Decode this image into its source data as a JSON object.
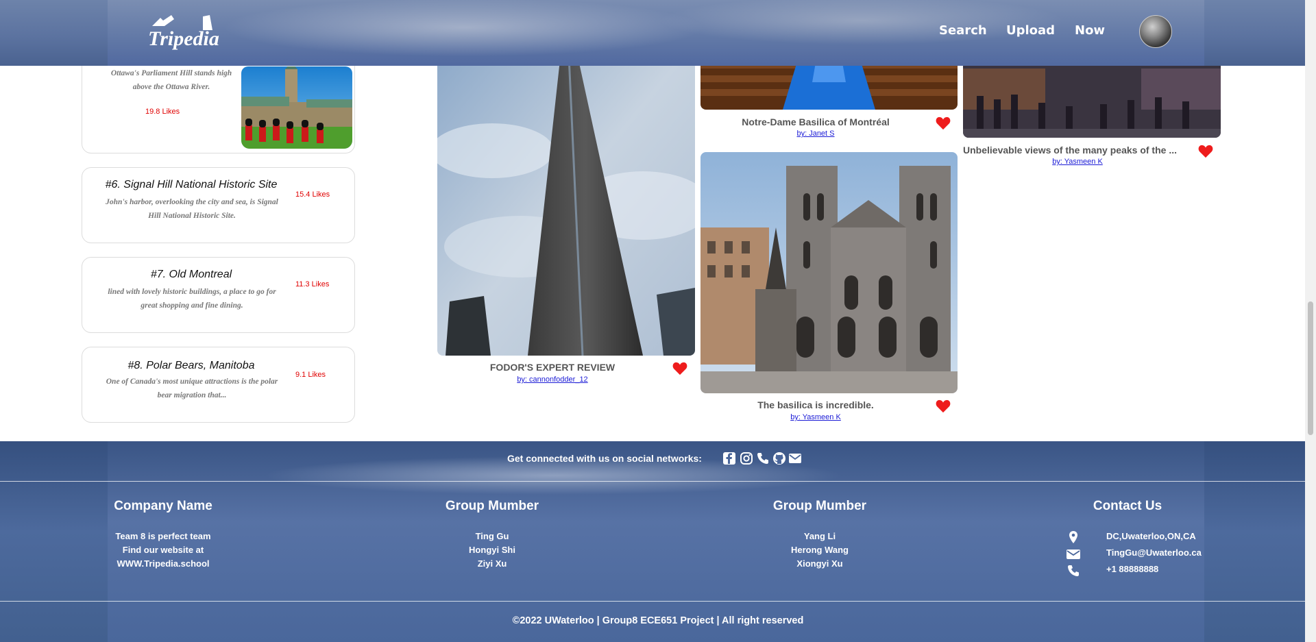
{
  "header": {
    "logo_text": "Tripedia",
    "nav": [
      {
        "label": "Search"
      },
      {
        "label": "Upload"
      },
      {
        "label": "Now"
      }
    ]
  },
  "rankings": [
    {
      "title": "",
      "desc_line1": "Ottawa's Parliament Hill stands high",
      "desc_line2": "above the Ottawa River.",
      "likes": "19.8 Likes"
    },
    {
      "title": "#6. Signal Hill National Historic Site",
      "desc_line1": "John's harbor, overlooking the city and sea, is Signal",
      "desc_line2": "Hill National Historic Site.",
      "likes": "15.4 Likes"
    },
    {
      "title": "#7. Old Montreal",
      "desc_line1": "lined with lovely historic buildings, a place to go for",
      "desc_line2": "great shopping and fine dining.",
      "likes": "11.3 Likes"
    },
    {
      "title": "#8. Polar Bears, Manitoba",
      "desc_line1": "One of Canada's most unique attractions is the polar",
      "desc_line2": "bear migration that...",
      "likes": "9.1 Likes"
    }
  ],
  "photos": [
    {
      "caption": "FODOR'S EXPERT REVIEW",
      "author": "by: cannonfodder_12"
    },
    {
      "caption": "Notre-Dame Basilica of Montréal",
      "author": "by: Janet S"
    },
    {
      "caption": "The basilica is incredible.",
      "author": "by: Yasmeen K"
    },
    {
      "caption": "Unbelievable views of the many peaks of the ...",
      "author": "by: Yasmeen K"
    }
  ],
  "footer": {
    "social_text": "Get connected with us on social networks:",
    "columns": [
      {
        "title": "Company Name",
        "lines": [
          "Team 8 is perfect team",
          "Find our website at",
          "WWW.Tripedia.school"
        ]
      },
      {
        "title": "Group Mumber",
        "lines": [
          "Ting Gu",
          "Hongyi Shi",
          "Ziyi Xu"
        ]
      },
      {
        "title": "Group Mumber",
        "lines": [
          "Yang Li",
          "Herong Wang",
          "Xiongyi Xu"
        ]
      }
    ],
    "contact": {
      "title": "Contact Us",
      "address": "DC,Uwaterloo,ON,CA",
      "email": "TingGu@Uwaterloo.ca",
      "phone": "+1 88888888"
    },
    "copyright": "©2022 UWaterloo | Group8 ECE651 Project | All right reserved"
  },
  "colors": {
    "likes": "#e00000",
    "heart": "#ee1c1c",
    "author_link": "#1a1ad6",
    "header_bg": "#5c73a0",
    "footer_bg": "#4d6a9d"
  }
}
